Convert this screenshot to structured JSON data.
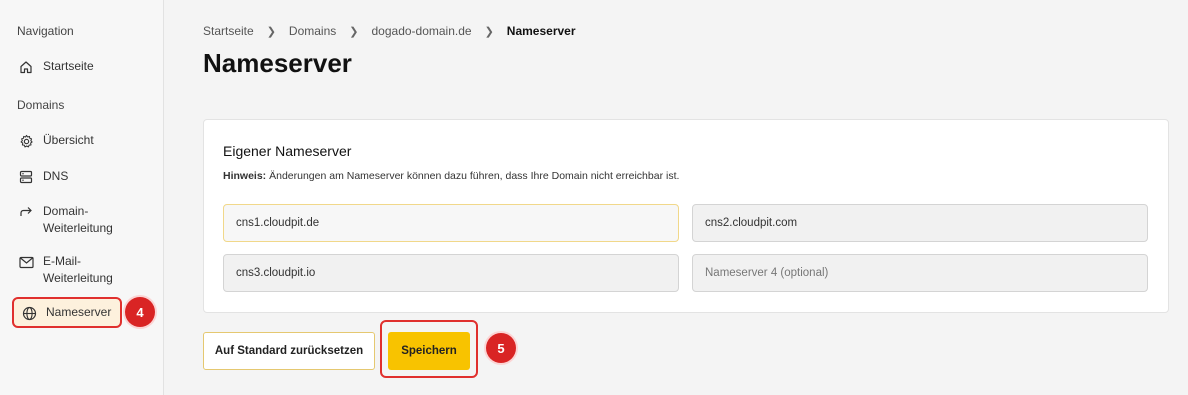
{
  "sidebar": {
    "navigation_heading": "Navigation",
    "domains_heading": "Domains",
    "items": [
      {
        "label": "Startseite",
        "icon": "home-icon"
      },
      {
        "label": "Übersicht",
        "icon": "gear-icon"
      },
      {
        "label": "DNS",
        "icon": "server-icon"
      },
      {
        "label": "Domain-Weiterleitung",
        "icon": "redirect-arrow-icon"
      },
      {
        "label": "E-Mail-Weiterleitung",
        "icon": "mail-icon"
      },
      {
        "label": "Nameserver",
        "icon": "globe-icon",
        "active": true
      }
    ]
  },
  "markers": {
    "step4": "4",
    "step5": "5"
  },
  "breadcrumb": [
    "Startseite",
    "Domains",
    "dogado-domain.de",
    "Nameserver"
  ],
  "page_title": "Nameserver",
  "card": {
    "title": "Eigener Nameserver",
    "hint_label": "Hinweis:",
    "hint_text": " Änderungen am Nameserver können dazu führen, dass Ihre Domain nicht erreichbar ist.",
    "fields": [
      {
        "value": "cns1.cloudpit.de",
        "placeholder": ""
      },
      {
        "value": "cns2.cloudpit.com",
        "placeholder": ""
      },
      {
        "value": "cns3.cloudpit.io",
        "placeholder": ""
      },
      {
        "value": "",
        "placeholder": "Nameserver 4 (optional)"
      }
    ]
  },
  "buttons": {
    "reset": "Auf Standard zurücksetzen",
    "save": "Speichern"
  },
  "colors": {
    "accent": "#f8c300",
    "highlight_red": "#e0302e",
    "active_bg": "#fdf1dd"
  }
}
